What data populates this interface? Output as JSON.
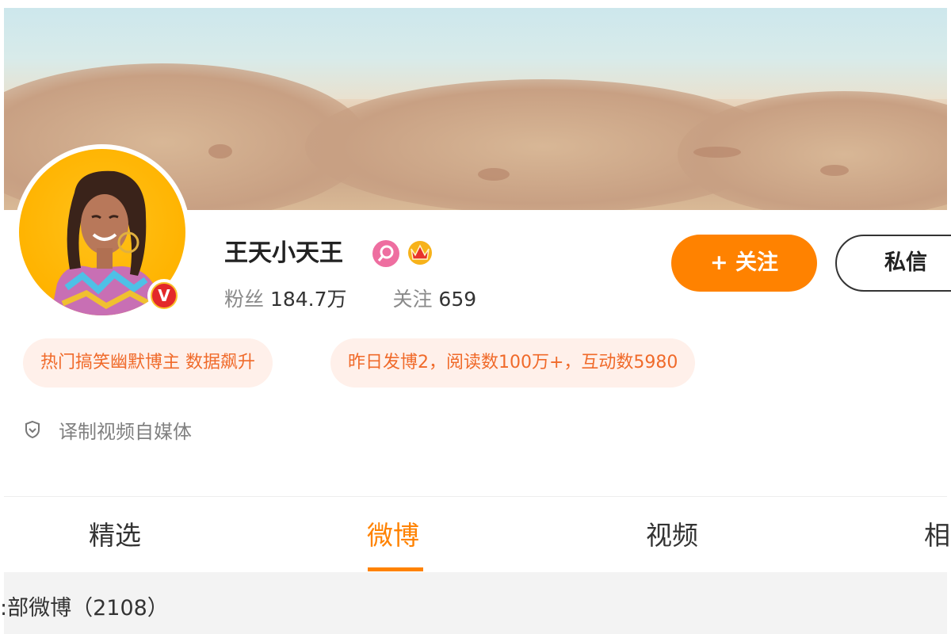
{
  "profile": {
    "name": "王天小天王",
    "followers_label": "粉丝",
    "followers_value": "184.7万",
    "following_label": "关注",
    "following_value": "659",
    "verified_mark": "V"
  },
  "actions": {
    "follow_label": "+ 关注",
    "message_label": "私信"
  },
  "tags": [
    "热门搞笑幽默博主 数据飙升",
    "昨日发博2，阅读数100万+，互动数5980"
  ],
  "verification": "译制视频自媒体",
  "tabs": [
    "精选",
    "微博",
    "视频",
    "相"
  ],
  "active_tab": "微博",
  "feed": {
    "title": ":部微博（2108）"
  },
  "colors": {
    "accent": "#ff8200",
    "tag_bg": "#fff0ea",
    "tag_text": "#f06a2a",
    "verified_badge": "#e3282a"
  }
}
